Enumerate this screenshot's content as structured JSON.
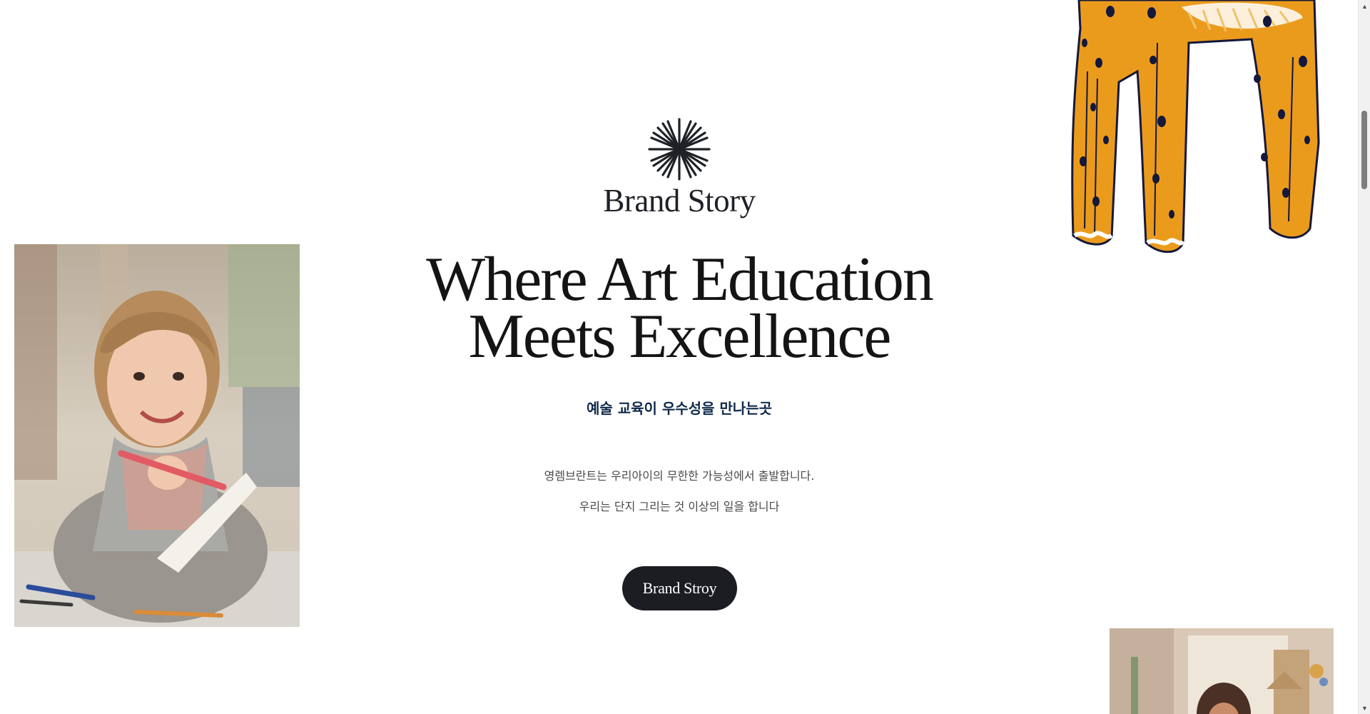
{
  "section": {
    "eyebrow": "Brand Story",
    "headline_line1": "Where Art Education",
    "headline_line2": "Meets Excellence",
    "subtitle_kr": "예술 교육이 우수성을 만나는곳",
    "description_line1": "영렘브란트는 우리아이의 무한한 가능성에서 출발합니다.",
    "description_line2": "우리는 단지 그리는 것 이상의 일을 합니다",
    "cta_label": "Brand Stroy"
  },
  "colors": {
    "background": "#ffffff",
    "headline": "#141414",
    "subtitle": "#0f2a4a",
    "button_bg": "#1c1d22",
    "leopard_fill": "#eb9b1c",
    "leopard_spot": "#14183a"
  },
  "icons": {
    "brand_mark": "starburst-icon",
    "scroll_up": "arrow-up-icon",
    "scroll_down": "arrow-down-icon"
  }
}
